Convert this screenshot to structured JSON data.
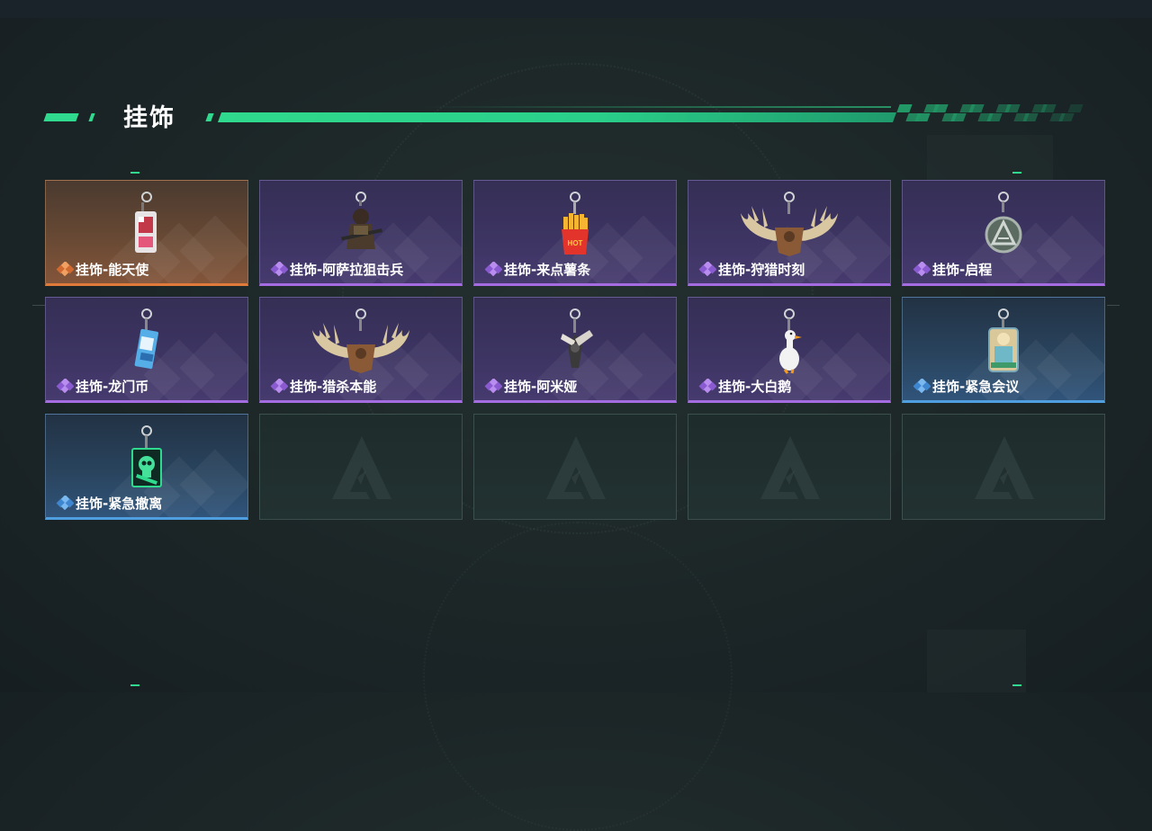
{
  "page": {
    "title": "挂饰"
  },
  "colors": {
    "accent_green": "#2fd98d",
    "rarity_purple": "#a56be0",
    "rarity_orange": "#e07a3a",
    "rarity_blue": "#4f9ee0"
  },
  "items": [
    {
      "label": "挂饰-能天使",
      "rarity": "orange",
      "icon": "pendant-keychain-icon"
    },
    {
      "label": "挂饰-阿萨拉狙击兵",
      "rarity": "purple",
      "icon": "sniper-figure-icon"
    },
    {
      "label": "挂饰-来点薯条",
      "rarity": "purple",
      "icon": "fries-icon"
    },
    {
      "label": "挂饰-狩猎时刻",
      "rarity": "purple",
      "icon": "antlers-icon"
    },
    {
      "label": "挂饰-启程",
      "rarity": "purple",
      "icon": "medal-icon"
    },
    {
      "label": "挂饰-龙门币",
      "rarity": "purple",
      "icon": "coin-card-icon"
    },
    {
      "label": "挂饰-猎杀本能",
      "rarity": "purple",
      "icon": "antlers-icon"
    },
    {
      "label": "挂饰-阿米娅",
      "rarity": "purple",
      "icon": "rabbit-figure-icon"
    },
    {
      "label": "挂饰-大白鹅",
      "rarity": "purple",
      "icon": "goose-icon"
    },
    {
      "label": "挂饰-紧急会议",
      "rarity": "blue",
      "icon": "figure-badge-icon"
    },
    {
      "label": "挂饰-紧急撤离",
      "rarity": "blue",
      "icon": "skull-box-icon"
    }
  ],
  "empty_slots": 4
}
